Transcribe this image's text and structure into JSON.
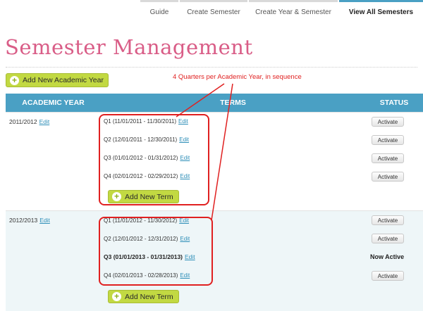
{
  "nav": {
    "tabs": [
      "Guide",
      "Create Semester",
      "Create Year & Semester",
      "View All Semesters"
    ],
    "active_index": 3
  },
  "page_title": "Semester Management",
  "add_year_button": "Add New Academic Year",
  "annotation": "4 Quarters per Academic Year, in sequence",
  "table": {
    "headers": {
      "year": "ACADEMIC YEAR",
      "terms": "TERMS",
      "status": "STATUS"
    },
    "edit_label": "Edit",
    "add_term_label": "Add New Term",
    "rows": [
      {
        "year": "2011/2012",
        "terms": [
          {
            "label": "Q1 (11/01/2011 - 11/30/2011)",
            "status": "Activate"
          },
          {
            "label": "Q2 (12/01/2011 - 12/30/2011)",
            "status": "Activate"
          },
          {
            "label": "Q3 (01/01/2012 - 01/31/2012)",
            "status": "Activate"
          },
          {
            "label": "Q4 (02/01/2012 - 02/29/2012)",
            "status": "Activate"
          }
        ]
      },
      {
        "year": "2012/2013",
        "terms": [
          {
            "label": "Q1 (11/01/2012 - 11/30/2012)",
            "status": "Activate"
          },
          {
            "label": "Q2 (12/01/2012 - 12/31/2012)",
            "status": "Activate"
          },
          {
            "label": "Q3 (01/01/2013 - 01/31/2013)",
            "status": "Now Active"
          },
          {
            "label": "Q4 (02/01/2013 - 02/28/2013)",
            "status": "Activate"
          }
        ]
      }
    ]
  },
  "colors": {
    "accent": "#4aa0c4",
    "title": "#d95d87",
    "button": "#c2d942",
    "annotation": "#e02020",
    "link": "#2f8fb8"
  }
}
